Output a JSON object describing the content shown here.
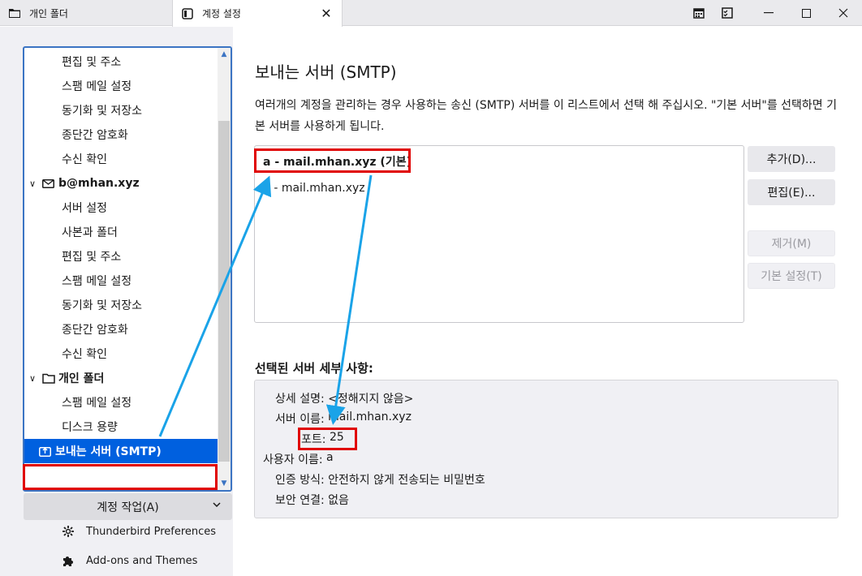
{
  "tabs": [
    {
      "label": "개인 폴더",
      "icon": "folder-icon"
    },
    {
      "label": "계정 설정",
      "icon": "settings-page-icon"
    }
  ],
  "sidebar": {
    "items": [
      {
        "label": "편집 및 주소",
        "kind": "child"
      },
      {
        "label": "스팸 메일 설정",
        "kind": "child"
      },
      {
        "label": "동기화 및 저장소",
        "kind": "child"
      },
      {
        "label": "종단간 암호화",
        "kind": "child"
      },
      {
        "label": "수신 확인",
        "kind": "child"
      },
      {
        "label": "b@mhan.xyz",
        "kind": "account"
      },
      {
        "label": "서버 설정",
        "kind": "child"
      },
      {
        "label": "사본과 폴더",
        "kind": "child"
      },
      {
        "label": "편집 및 주소",
        "kind": "child"
      },
      {
        "label": "스팸 메일 설정",
        "kind": "child"
      },
      {
        "label": "동기화 및 저장소",
        "kind": "child"
      },
      {
        "label": "종단간 암호화",
        "kind": "child"
      },
      {
        "label": "수신 확인",
        "kind": "child"
      },
      {
        "label": "개인 폴더",
        "kind": "folder"
      },
      {
        "label": "스팸 메일 설정",
        "kind": "child"
      },
      {
        "label": "디스크 용량",
        "kind": "child"
      },
      {
        "label": "보내는 서버 (SMTP)",
        "kind": "selected"
      }
    ],
    "account_actions_label": "계정 작업(A)",
    "links": [
      {
        "label": "Thunderbird Preferences",
        "icon": "gear-icon"
      },
      {
        "label": "Add-ons and Themes",
        "icon": "puzzle-icon"
      }
    ]
  },
  "main": {
    "title": "보내는 서버 (SMTP)",
    "description": "여러개의 계정을 관리하는 경우 사용하는 송신 (SMTP) 서버를 이 리스트에서 선택 해 주십시오. \"기본 서버\"를 선택하면 기본 서버를 사용하게 됩니다.",
    "servers": [
      "a - mail.mhan.xyz (기본)",
      "b - mail.mhan.xyz"
    ],
    "buttons": {
      "add": "추가(D)...",
      "edit": "편집(E)...",
      "remove": "제거(M)",
      "set_default": "기본 설정(T)"
    },
    "details_title": "선택된 서버 세부 사항:",
    "details": [
      {
        "label": "상세 설명:",
        "value": "<정해지지 않음>"
      },
      {
        "label": "서버 이름:",
        "value": "mail.mhan.xyz"
      },
      {
        "label": "포트:",
        "value": "25"
      },
      {
        "label": "사용자 이름:",
        "value": "a"
      },
      {
        "label": "인증 방식:",
        "value": "안전하지 않게 전송되는 비밀번호"
      },
      {
        "label": "보안 연결:",
        "value": "없음"
      }
    ]
  },
  "colors": {
    "selection": "#0060df",
    "highlight_box": "#e00000",
    "arrow": "#1aa3e8"
  }
}
